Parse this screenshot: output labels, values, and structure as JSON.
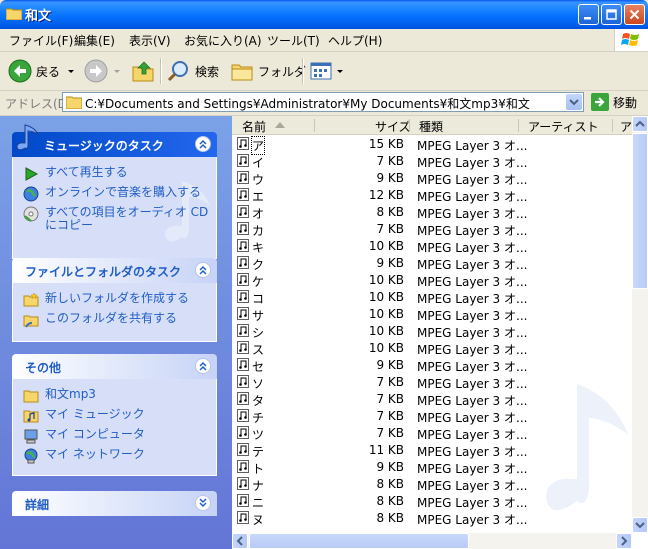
{
  "window": {
    "title": "和文"
  },
  "menu": [
    "ファイル(F)",
    "編集(E)",
    "表示(V)",
    "お気に入り(A)",
    "ツール(T)",
    "ヘルプ(H)"
  ],
  "toolbar": {
    "back_label": "戻る",
    "search_label": "検索",
    "folders_label": "フォルダ"
  },
  "address": {
    "label": "アドレス(D)",
    "path": "C:¥Documents and Settings¥Administrator¥My Documents¥和文mp3¥和文",
    "go_label": "移動"
  },
  "tasks": {
    "music": {
      "title": "ミュージックのタスク",
      "items": [
        "すべて再生する",
        "オンラインで音楽を購入する",
        "すべての項目をオーディオ CD",
        "にコピー"
      ]
    },
    "file_folder": {
      "title": "ファイルとフォルダのタスク",
      "items": [
        "新しいフォルダを作成する",
        "このフォルダを共有する"
      ]
    },
    "other": {
      "title": "その他",
      "items": [
        "和文mp3",
        "マイ ミュージック",
        "マイ コンピュータ",
        "マイ ネットワーク"
      ]
    },
    "details": {
      "title": "詳細"
    }
  },
  "columns": [
    "名前",
    "サイズ",
    "種類",
    "アーティスト",
    "ア"
  ],
  "files": [
    {
      "name": "ア",
      "size": "15 KB",
      "type": "MPEG Layer 3 オ..."
    },
    {
      "name": "イ",
      "size": "7 KB",
      "type": "MPEG Layer 3 オ..."
    },
    {
      "name": "ウ",
      "size": "9 KB",
      "type": "MPEG Layer 3 オ..."
    },
    {
      "name": "エ",
      "size": "12 KB",
      "type": "MPEG Layer 3 オ..."
    },
    {
      "name": "オ",
      "size": "8 KB",
      "type": "MPEG Layer 3 オ..."
    },
    {
      "name": "カ",
      "size": "7 KB",
      "type": "MPEG Layer 3 オ..."
    },
    {
      "name": "キ",
      "size": "10 KB",
      "type": "MPEG Layer 3 オ..."
    },
    {
      "name": "ク",
      "size": "9 KB",
      "type": "MPEG Layer 3 オ..."
    },
    {
      "name": "ケ",
      "size": "10 KB",
      "type": "MPEG Layer 3 オ..."
    },
    {
      "name": "コ",
      "size": "10 KB",
      "type": "MPEG Layer 3 オ..."
    },
    {
      "name": "サ",
      "size": "10 KB",
      "type": "MPEG Layer 3 オ..."
    },
    {
      "name": "シ",
      "size": "10 KB",
      "type": "MPEG Layer 3 オ..."
    },
    {
      "name": "ス",
      "size": "10 KB",
      "type": "MPEG Layer 3 オ..."
    },
    {
      "name": "セ",
      "size": "9 KB",
      "type": "MPEG Layer 3 オ..."
    },
    {
      "name": "ソ",
      "size": "7 KB",
      "type": "MPEG Layer 3 オ..."
    },
    {
      "name": "タ",
      "size": "7 KB",
      "type": "MPEG Layer 3 オ..."
    },
    {
      "name": "チ",
      "size": "7 KB",
      "type": "MPEG Layer 3 オ..."
    },
    {
      "name": "ツ",
      "size": "7 KB",
      "type": "MPEG Layer 3 オ..."
    },
    {
      "name": "テ",
      "size": "11 KB",
      "type": "MPEG Layer 3 オ..."
    },
    {
      "name": "ト",
      "size": "9 KB",
      "type": "MPEG Layer 3 オ..."
    },
    {
      "name": "ナ",
      "size": "8 KB",
      "type": "MPEG Layer 3 オ..."
    },
    {
      "name": "ニ",
      "size": "8 KB",
      "type": "MPEG Layer 3 オ..."
    },
    {
      "name": "ヌ",
      "size": "8 KB",
      "type": "MPEG Layer 3 オ..."
    }
  ],
  "colors": {
    "title_bar": "#0054e3",
    "task_pane": "#7ba2e7",
    "link": "#215dc6"
  },
  "icons": [
    "folder-icon",
    "back-icon",
    "forward-icon",
    "up-icon",
    "search-icon",
    "folders-icon",
    "views-icon",
    "go-icon",
    "music-note-icon",
    "play-icon",
    "globe-icon",
    "cd-icon",
    "new-folder-icon",
    "share-icon",
    "my-music-icon",
    "my-computer-icon",
    "my-network-icon",
    "audio-file-icon"
  ]
}
